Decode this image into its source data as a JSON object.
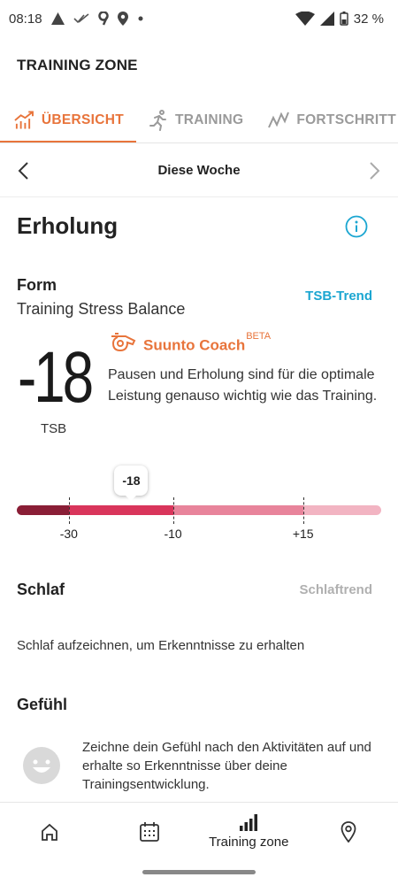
{
  "status_bar": {
    "time": "08:18",
    "battery": "32 %"
  },
  "app": {
    "title": "TRAINING ZONE"
  },
  "tabs": [
    {
      "label": "ÜBERSICHT",
      "icon": "bar-trend-icon",
      "active": true
    },
    {
      "label": "TRAINING",
      "icon": "runner-icon",
      "active": false
    },
    {
      "label": "FORTSCHRITT",
      "icon": "progress-wave-icon",
      "active": false
    }
  ],
  "week": {
    "label": "Diese Woche"
  },
  "recovery": {
    "title": "Erholung",
    "form": {
      "title": "Form",
      "subtitle": "Training Stress Balance",
      "trend_link": "TSB-Trend"
    },
    "tsb": {
      "value": "-18",
      "unit": "TSB"
    },
    "coach": {
      "name": "Suunto Coach",
      "badge": "BETA",
      "text": "Pausen und Erholung sind für die optimale Leistung genauso wichtig wie das Training."
    },
    "gauge": {
      "marker_label": "-18",
      "marker_value": -18,
      "scale_min": -40,
      "scale_max": 30,
      "ticks": [
        {
          "value": -30,
          "label": "-30"
        },
        {
          "value": -10,
          "label": "-10"
        },
        {
          "value": 15,
          "label": "+15"
        }
      ],
      "segment_colors": [
        "#8a1e36",
        "#d9355b",
        "#e8849b",
        "#f2b4c2"
      ]
    }
  },
  "sleep": {
    "title": "Schlaf",
    "trend_link": "Schlaftrend",
    "text": "Schlaf aufzeichnen, um Erkenntnisse zu erhalten"
  },
  "feeling": {
    "title": "Gefühl",
    "text": "Zeichne dein Gefühl nach den Aktivitäten auf und erhalte so Erkenntnisse über deine Trainingsentwicklung."
  },
  "bottom_nav": [
    {
      "icon": "home-icon",
      "label": ""
    },
    {
      "icon": "calendar-icon",
      "label": ""
    },
    {
      "icon": "training-zone-icon",
      "label": "Training zone"
    },
    {
      "icon": "map-pin-icon",
      "label": ""
    }
  ],
  "colors": {
    "accent": "#e8743b",
    "link": "#1ba6d1",
    "muted": "#b0b0b0"
  }
}
